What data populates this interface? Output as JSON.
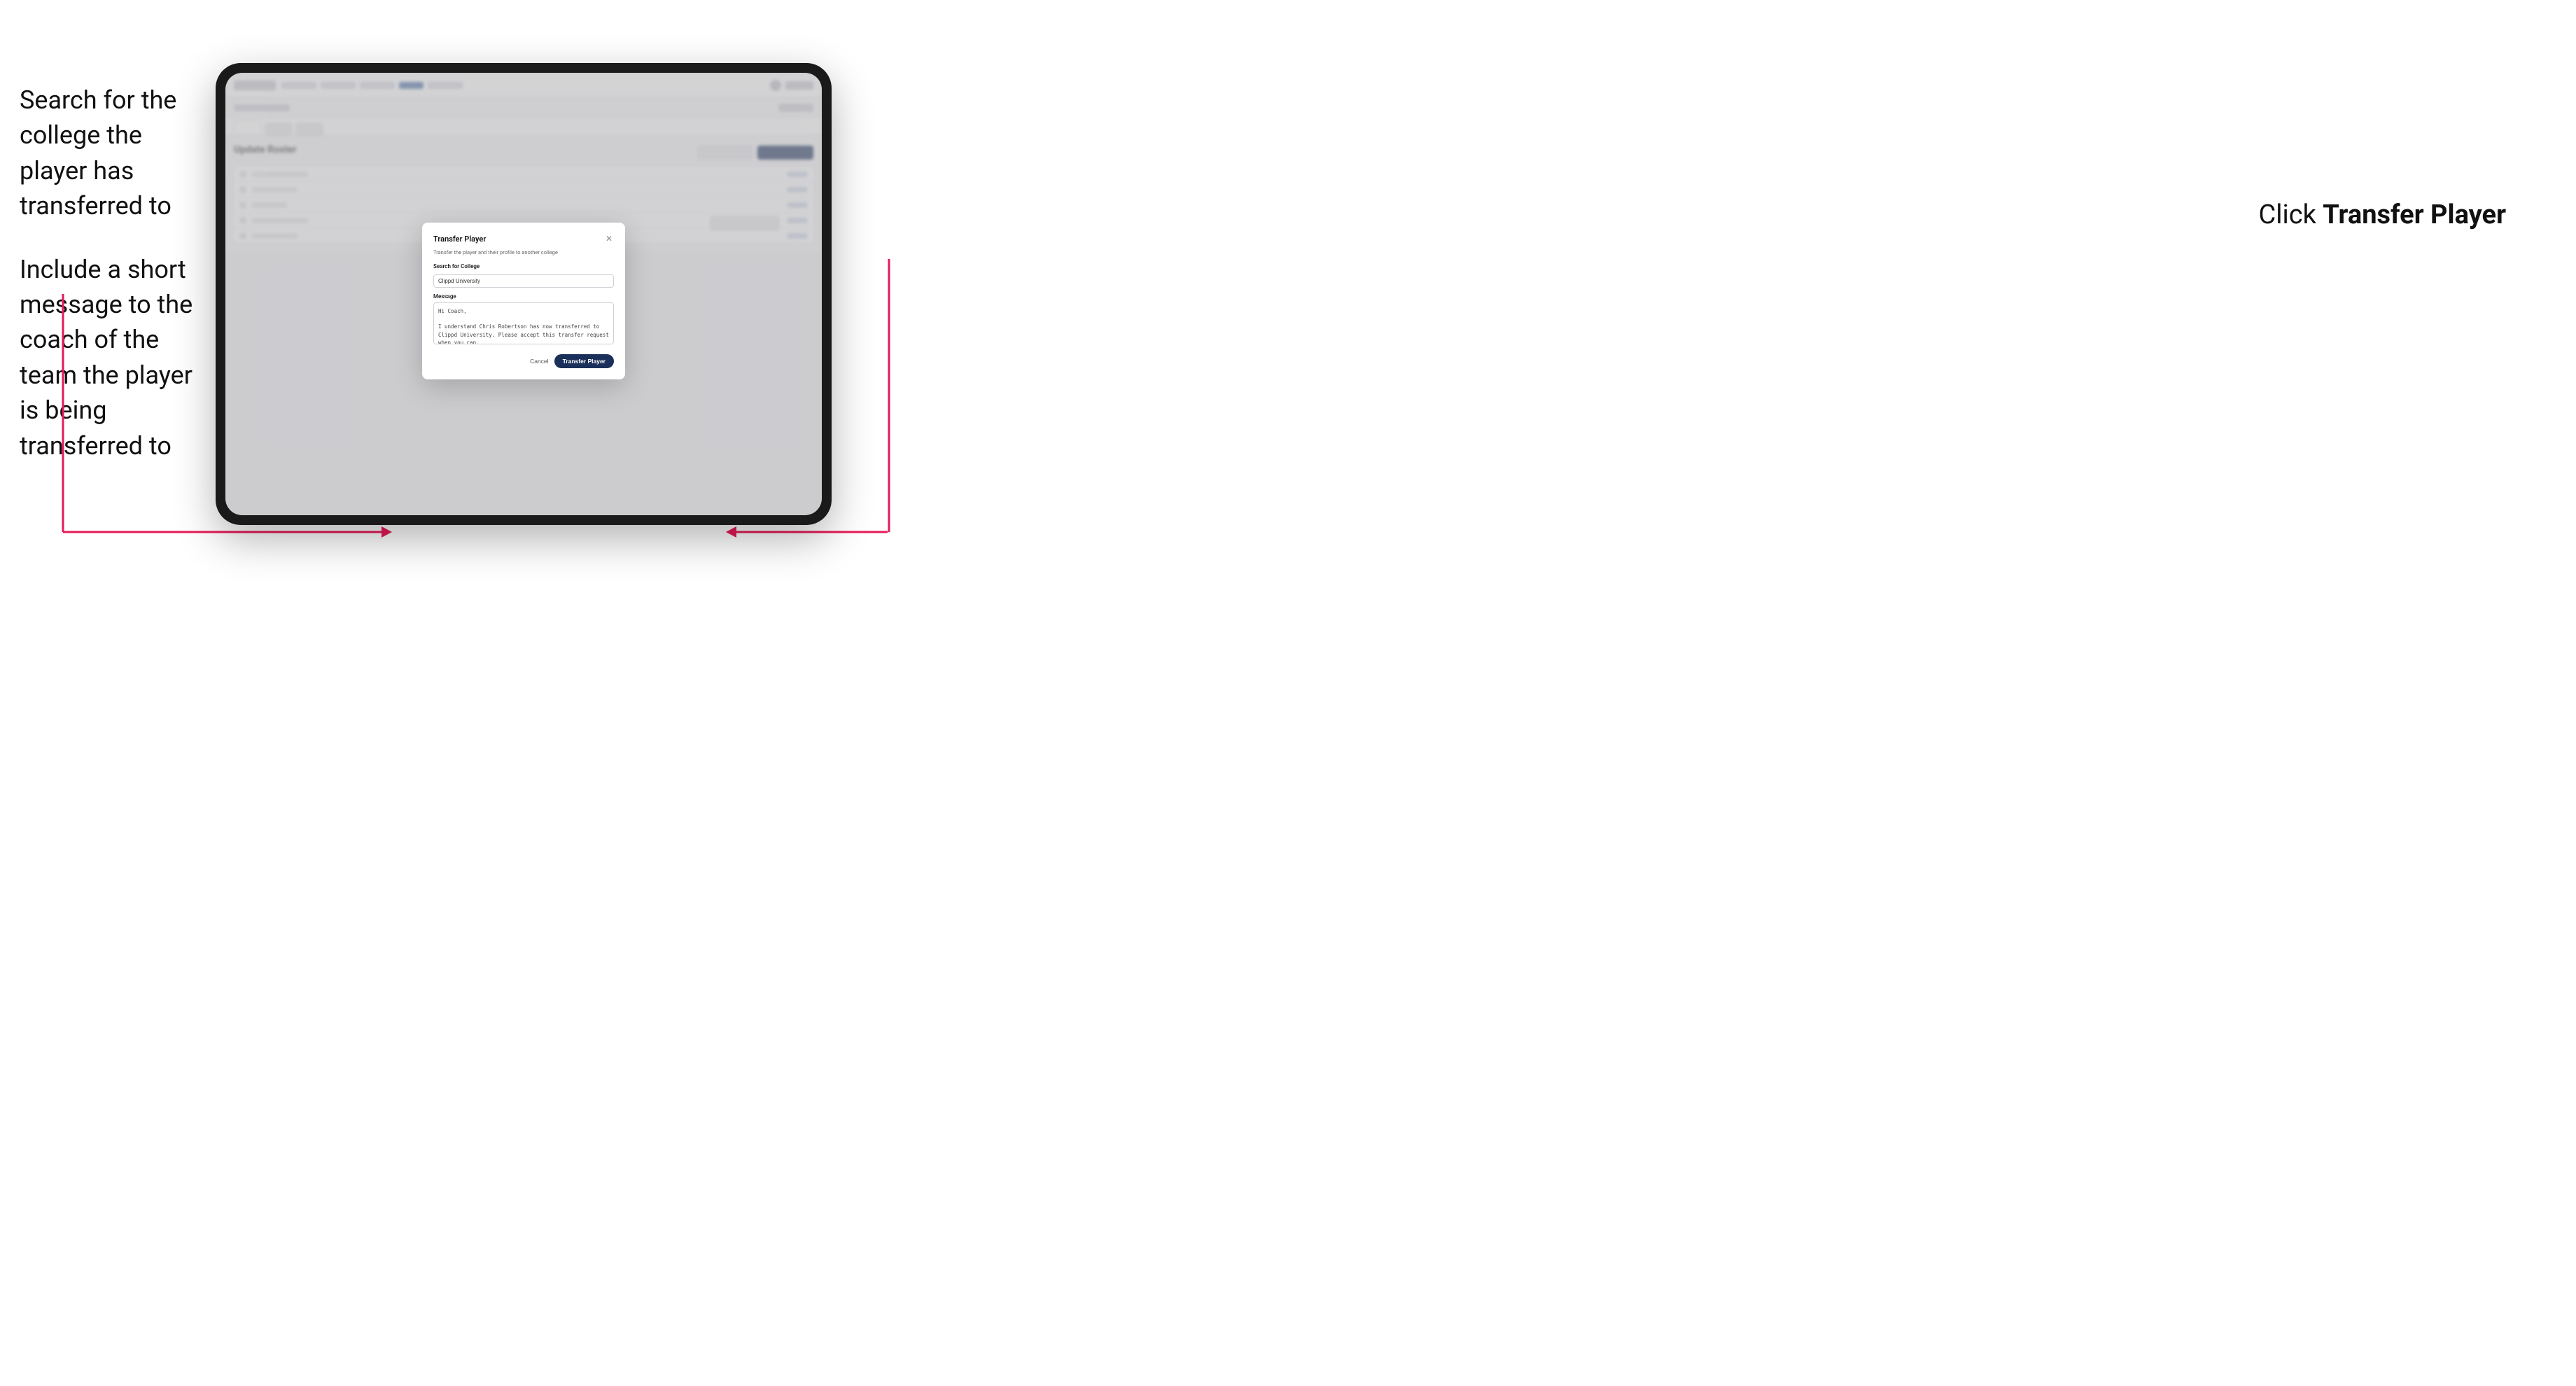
{
  "annotations": {
    "left_title1": "Search for the college the player has transferred to",
    "left_title2": "Include a short message to the coach of the team the player is being transferred to",
    "right_label": "Click ",
    "right_bold": "Transfer Player"
  },
  "modal": {
    "title": "Transfer Player",
    "description": "Transfer the player and their profile to another college",
    "search_label": "Search for College",
    "search_value": "Clippd University",
    "message_label": "Message",
    "message_value": "Hi Coach,\n\nI understand Chris Robertson has now transferred to Clippd University. Please accept this transfer request when you can.",
    "cancel_label": "Cancel",
    "transfer_label": "Transfer Player"
  },
  "app": {
    "page_title": "Update Roster"
  }
}
